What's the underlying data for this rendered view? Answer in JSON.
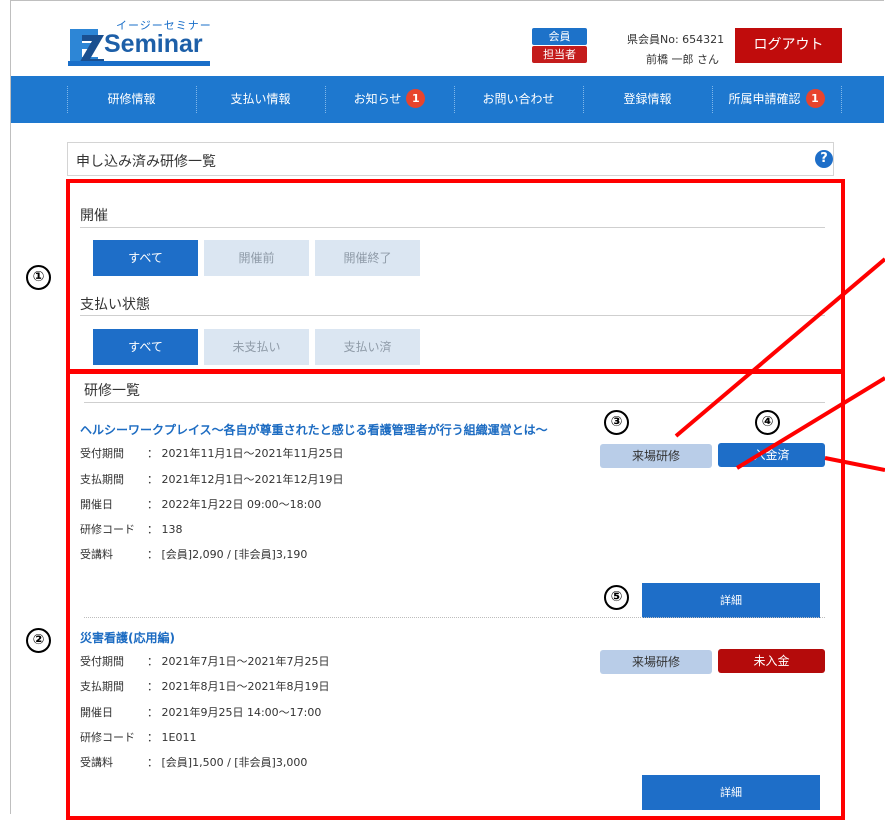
{
  "header": {
    "logo_kana": "イージーセミナー",
    "logo_word": "Seminar",
    "role_member": "会員",
    "role_staff": "担当者",
    "member_no": "県会員No: 654321",
    "user_name": "前橋 一郎 さん",
    "logout_label": "ログアウト"
  },
  "nav": {
    "items": [
      {
        "label": "研修情報"
      },
      {
        "label": "支払い情報"
      },
      {
        "label": "お知らせ",
        "badge": "1"
      },
      {
        "label": "お問い合わせ"
      },
      {
        "label": "登録情報"
      },
      {
        "label": "所属申請確認",
        "badge": "1"
      }
    ]
  },
  "page_title": "申し込み済み研修一覧",
  "help_icon": "?",
  "filters": {
    "held_label": "開催",
    "held_options": [
      "すべて",
      "開催前",
      "開催終了"
    ],
    "held_selected": "すべて",
    "payment_label": "支払い状態",
    "payment_options": [
      "すべて",
      "未支払い",
      "支払い済"
    ],
    "payment_selected": "すべて"
  },
  "list": {
    "heading": "研修一覧",
    "courses": [
      {
        "title": "ヘルシーワークプレイス～各自が尊重されたと感じる看護管理者が行う組織運営とは～",
        "rows": [
          {
            "k": "受付期間",
            "v": "： 2021年11月1日～2021年11月25日"
          },
          {
            "k": "支払期間",
            "v": "： 2021年12月1日～2021年12月19日"
          },
          {
            "k": "開催日",
            "v": "： 2022年1月22日  09:00～18:00"
          },
          {
            "k": "研修コード",
            "v": "： 138"
          },
          {
            "k": "受講料",
            "v": "： [会員]2,090 / [非会員]3,190"
          }
        ],
        "type_tag": "来場研修",
        "status_tag": "入金済",
        "detail_label": "詳細"
      },
      {
        "title": "災害看護(応用編)",
        "rows": [
          {
            "k": "受付期間",
            "v": "： 2021年7月1日～2021年7月25日"
          },
          {
            "k": "支払期間",
            "v": "： 2021年8月1日～2021年8月19日"
          },
          {
            "k": "開催日",
            "v": "： 2021年9月25日  14:00～17:00"
          },
          {
            "k": "研修コード",
            "v": "： 1E011"
          },
          {
            "k": "受講料",
            "v": "： [会員]1,500 / [非会員]3,000"
          }
        ],
        "type_tag": "来場研修",
        "status_tag": "未入金",
        "detail_label": "詳細"
      }
    ]
  },
  "annotations": {
    "markers": [
      "①",
      "②",
      "③",
      "④",
      "⑤"
    ],
    "color": "#ff0000"
  },
  "colors": {
    "nav_bg": "#1e78cf",
    "primary": "#1e6ec8",
    "danger": "#c00c0c",
    "inactive": "#dbe6f2"
  }
}
